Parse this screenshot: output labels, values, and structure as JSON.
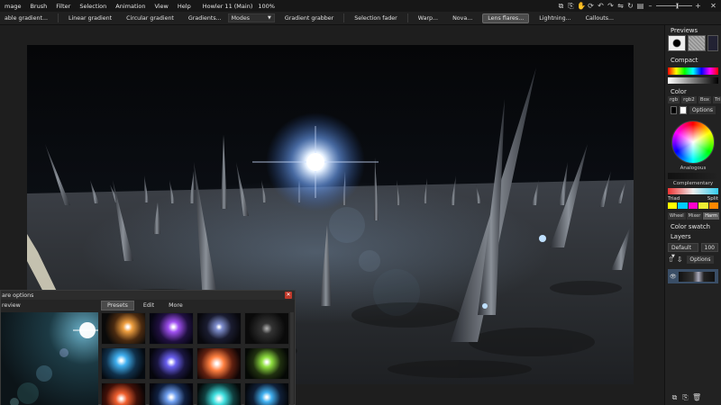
{
  "menubar": {
    "items": [
      "mage",
      "Brush",
      "Filter",
      "Selection",
      "Animation",
      "View",
      "Help"
    ],
    "window_title": "Howler 11 (Main)",
    "zoom": "100%"
  },
  "toolbar": {
    "items": [
      {
        "label": "able gradient...",
        "type": "button"
      },
      {
        "label": "Linear gradient",
        "type": "button"
      },
      {
        "label": "Circular gradient",
        "type": "button"
      },
      {
        "label": "Gradients...",
        "type": "button"
      },
      {
        "label": "Modes",
        "type": "select"
      },
      {
        "label": "Gradient grabber",
        "type": "button"
      },
      {
        "label": "Selection fader",
        "type": "button"
      },
      {
        "label": "Warp...",
        "type": "button"
      },
      {
        "label": "Nova...",
        "type": "button"
      },
      {
        "label": "Lens flares...",
        "type": "button",
        "active": true
      },
      {
        "label": "Lightning...",
        "type": "button"
      },
      {
        "label": "Callouts...",
        "type": "button"
      }
    ]
  },
  "panel": {
    "previews_title": "Previews",
    "compact_title": "Compact",
    "color_title": "Color",
    "color_tabs": [
      "rgb",
      "rgb2",
      "Box",
      "Tri"
    ],
    "options_label": "Options",
    "analogous_label": "Analogous",
    "complementary_label": "Complementary",
    "triad_label": "Triad",
    "split_label": "Split",
    "wheel_tabs": [
      "Wheel",
      "Mixer",
      "Harm"
    ],
    "swatch_title": "Color swatch",
    "layers_title": "Layers",
    "blend_mode": "Default",
    "opacity": "100",
    "layers_options": "Options"
  },
  "dialog": {
    "title": "are options",
    "preview_label": "review",
    "tabs": [
      "Presets",
      "Edit",
      "More"
    ],
    "active_tab": "Presets"
  },
  "colors": {
    "accent_active": "#4b4b4b",
    "layer_selected": "#3a4e66",
    "close_red": "#c0392b"
  }
}
